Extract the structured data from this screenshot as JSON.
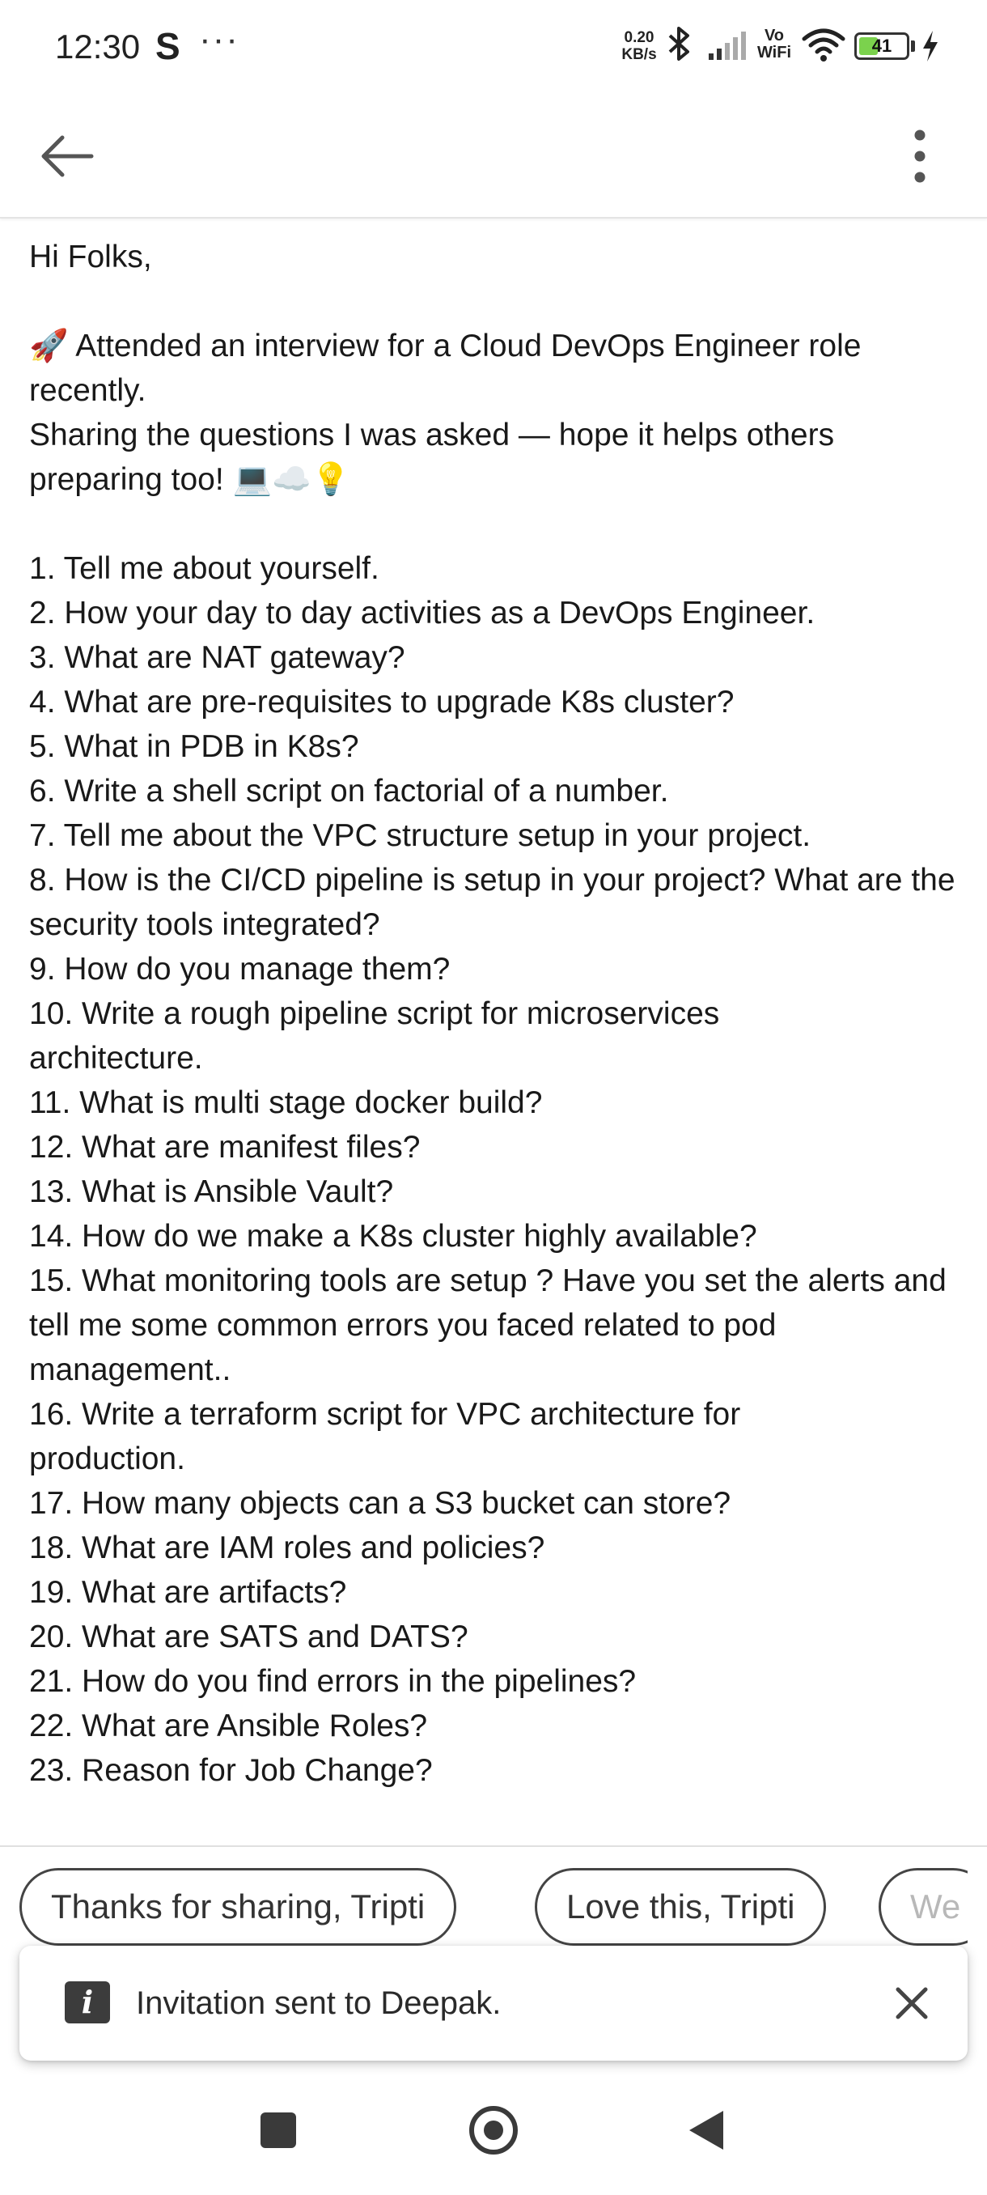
{
  "status_bar": {
    "time": "12:30",
    "app_indicator": "S",
    "more_dots": "···",
    "net_speed_value": "0.20",
    "net_speed_unit": "KB/s",
    "vowifi_top": "Vo",
    "vowifi_bottom": "WiFi",
    "battery_level": "41",
    "battery_fraction": 0.41,
    "battery_color": "#7bd24d",
    "icons": [
      "bluetooth-icon",
      "signal-icon",
      "wifi-icon",
      "battery-icon",
      "charging-icon"
    ]
  },
  "app_bar": {
    "back_icon": "arrow-left-icon",
    "menu_icon": "more-vertical-icon"
  },
  "post": {
    "greeting": "Hi Folks,",
    "intro_emoji": "🚀",
    "intro_line": "Attended an interview for a Cloud DevOps Engineer role recently.",
    "sharing_line": "Sharing the questions I was asked — hope it helps others preparing too!",
    "sharing_emojis": "💻☁️💡",
    "questions": [
      "1. Tell me about yourself.",
      "2. How your day to day activities as a DevOps Engineer.",
      "3. What are NAT gateway?",
      "4. What are pre-requisites to upgrade K8s cluster?",
      "5. What in PDB in K8s?",
      "6. Write a shell script on factorial of a number.",
      "7. Tell me about the VPC structure setup in your project.",
      "8. How is the CI/CD pipeline is setup in your project? What are the security tools integrated?",
      "9. How do you manage them?",
      "10. Write a rough pipeline script for microservices architecture.",
      "11. What is multi stage docker build?",
      "12. What are manifest files?",
      "13. What is Ansible Vault?",
      "14. How do we make a K8s cluster highly available?",
      "15. What monitoring tools are setup ? Have you set the alerts and tell me some common errors you faced related to pod management..",
      "16. Write a terraform script for VPC architecture for production.",
      "17. How many objects can a S3 bucket can store?",
      "18. What are IAM roles and policies?",
      "19. What are artifacts?",
      "20. What are SATS and DATS?",
      "21. How do you find errors in the pipelines?",
      "22. What are Ansible Roles?",
      "23. Reason for Job Change?"
    ]
  },
  "suggestions": {
    "chips": [
      "Thanks for sharing, Tripti",
      "Love this, Tripti",
      "We"
    ]
  },
  "toast": {
    "icon": "info-icon",
    "icon_glyph": "i",
    "message": "Invitation sent to Deepak.",
    "close_icon": "close-icon"
  },
  "nav_bar": {
    "icons": [
      "recents-square-icon",
      "home-circle-icon",
      "back-triangle-icon"
    ]
  }
}
